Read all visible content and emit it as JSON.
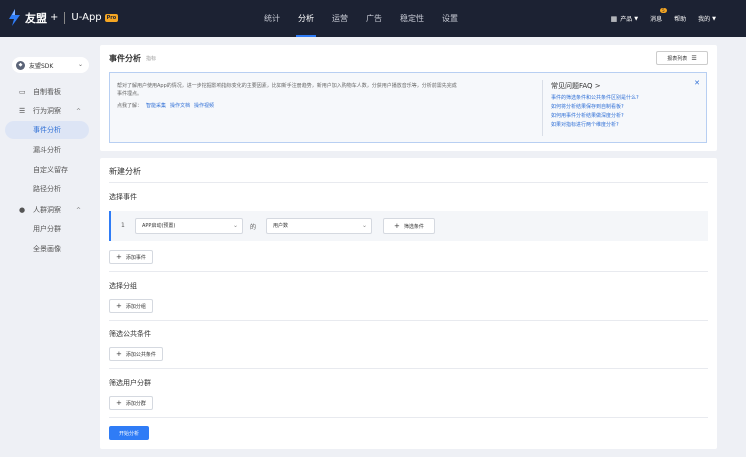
{
  "app": {
    "brand": "友盟",
    "plus": "+",
    "product": "U-App",
    "pro_badge": "Pro"
  },
  "nav": {
    "items": [
      {
        "label": "统计",
        "active": false
      },
      {
        "label": "分析",
        "active": true
      },
      {
        "label": "运营",
        "active": false
      },
      {
        "label": "广告",
        "active": false
      },
      {
        "label": "稳定性",
        "active": false
      },
      {
        "label": "设置",
        "active": false
      }
    ]
  },
  "top_right": {
    "products_label": "产品",
    "messages_label": "消息",
    "messages_count": "5",
    "help_label": "帮助",
    "mine_label": "我的"
  },
  "sidebar": {
    "sdk_label": "友盟SDK",
    "items": [
      {
        "label": "自制看板",
        "icon": "monitor-icon",
        "kind": "top"
      },
      {
        "label": "行为洞察",
        "icon": "list-icon",
        "kind": "group"
      },
      {
        "label": "事件分析",
        "kind": "child",
        "active": true
      },
      {
        "label": "漏斗分析",
        "kind": "child"
      },
      {
        "label": "自定义留存",
        "kind": "child"
      },
      {
        "label": "路径分析",
        "kind": "child"
      },
      {
        "label": "人群洞察",
        "icon": "user-icon",
        "kind": "group"
      },
      {
        "label": "用户分群",
        "kind": "child"
      },
      {
        "label": "全景画像",
        "kind": "child"
      }
    ]
  },
  "header_card": {
    "title": "事件分析",
    "subtitle": "指标",
    "report_list_label": "报表列表",
    "intro_text": "帮对了解用户使用App的情况，进一步挖掘影响指标变化的主要因素，比如新手注册趋势，新用户加入购物车人数，分获用户播放音乐等，分析前需先完成事件埋点。",
    "links_prefix": "点我了解：",
    "links": [
      "智能采集",
      "操作文档",
      "操作视频"
    ],
    "faq_title": "常见问题FAQ >",
    "faq_items": [
      "事件的筛选条件和公共条件区别是什么?",
      "如何将分析结果保存到自制看板?",
      "如何用事件分析结果做深度分析?",
      "如果对指标进行两个维度分析?"
    ]
  },
  "new_analysis": {
    "title": "新建分析",
    "choose_event_label": "选择事件",
    "event_row": {
      "index": "1",
      "event_value": "APP启动(预置)",
      "connector": "的",
      "metric_value": "用户数",
      "filter_label": "筛选条件"
    },
    "add_event_label": "添加事件",
    "choose_group_label": "选择分组",
    "add_group_label": "添加分组",
    "filter_common_label": "筛选公共条件",
    "add_common_label": "添加公共条件",
    "filter_segment_label": "筛选用户分群",
    "add_segment_label": "添加分群",
    "start_label": "开始分析"
  }
}
